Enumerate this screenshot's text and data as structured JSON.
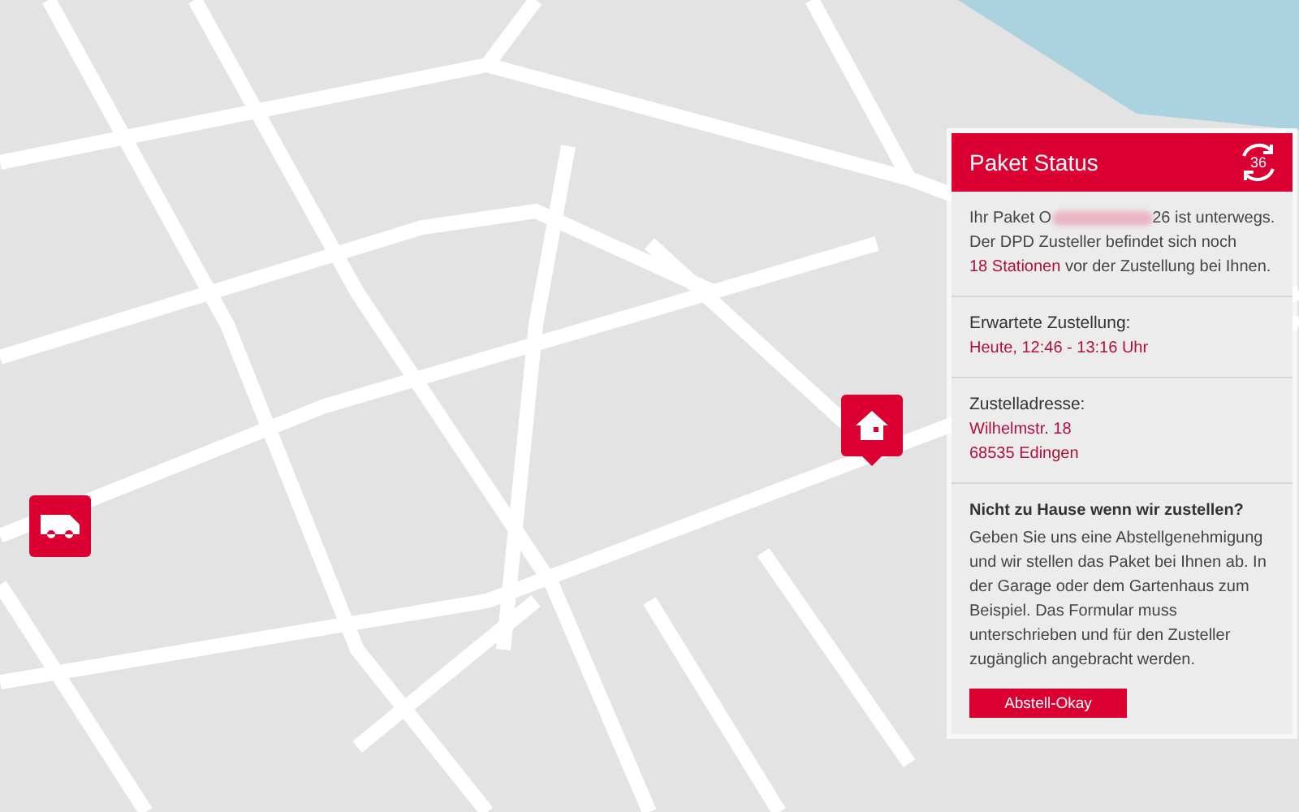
{
  "markers": [
    {
      "kind": "truck"
    },
    {
      "kind": "home"
    }
  ],
  "panel": {
    "title": "Paket Status",
    "refresh_badge": "36",
    "status": {
      "before": "Ihr Paket O",
      "redacted": true,
      "after": "26 ist unterwegs. Der DPD Zusteller befindet sich noch",
      "link": "18 Stationen",
      "end": "vor der Zustellung bei Ihnen."
    },
    "sections": [
      {
        "label": "Erwartete Zustellung:",
        "lines": [
          "Heute, 12:46 - 13:16 Uhr"
        ]
      },
      {
        "label": "Zustelladresse:",
        "lines": [
          "Wilhelmstr. 18",
          "68535 Edingen"
        ]
      }
    ],
    "notice": {
      "heading": "Nicht zu Hause wenn wir zustellen?",
      "text": "Geben Sie uns eine Abstellgenehmigung und wir stellen das Paket bei Ihnen ab. In der Garage oder dem Gartenhaus zum Beispiel. Das Formular muss unterschrieben und für den Zusteller zugänglich angebracht werden.",
      "button": "Abstell-Okay"
    }
  }
}
